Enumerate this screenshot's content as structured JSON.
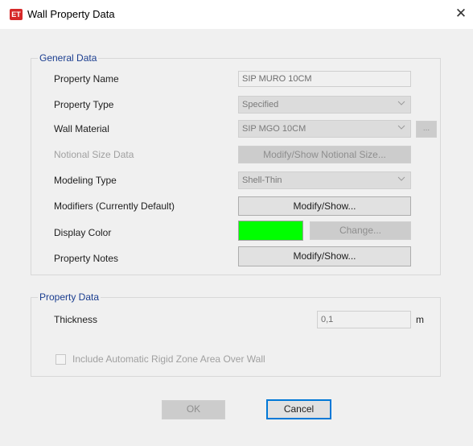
{
  "window": {
    "title": "Wall Property Data",
    "app_icon_text": "ET",
    "app_icon_color": "#d62828",
    "close_glyph": "✕"
  },
  "general": {
    "legend": "General Data",
    "property_name": {
      "label": "Property Name",
      "value": "SIP MURO 10CM"
    },
    "property_type": {
      "label": "Property Type",
      "value": "Specified"
    },
    "wall_material": {
      "label": "Wall Material",
      "value": "SIP MGO 10CM",
      "browse_label": "..."
    },
    "notional_size": {
      "label": "Notional Size Data",
      "button_label": "Modify/Show Notional Size..."
    },
    "modeling_type": {
      "label": "Modeling Type",
      "value": "Shell-Thin"
    },
    "modifiers": {
      "label": "Modifiers (Currently Default)",
      "button_label": "Modify/Show..."
    },
    "display_color": {
      "label": "Display Color",
      "color": "#00ff00",
      "change_label": "Change..."
    },
    "property_notes": {
      "label": "Property Notes",
      "button_label": "Modify/Show..."
    }
  },
  "property_data": {
    "legend": "Property Data",
    "thickness": {
      "label": "Thickness",
      "value": "0,1",
      "unit": "m"
    },
    "rigid_zone": {
      "label": "Include Automatic Rigid Zone Area Over Wall",
      "checked": false
    }
  },
  "footer": {
    "ok_label": "OK",
    "cancel_label": "Cancel"
  },
  "colors": {
    "accent": "#0078d7",
    "legend_text": "#1a3d8f"
  }
}
